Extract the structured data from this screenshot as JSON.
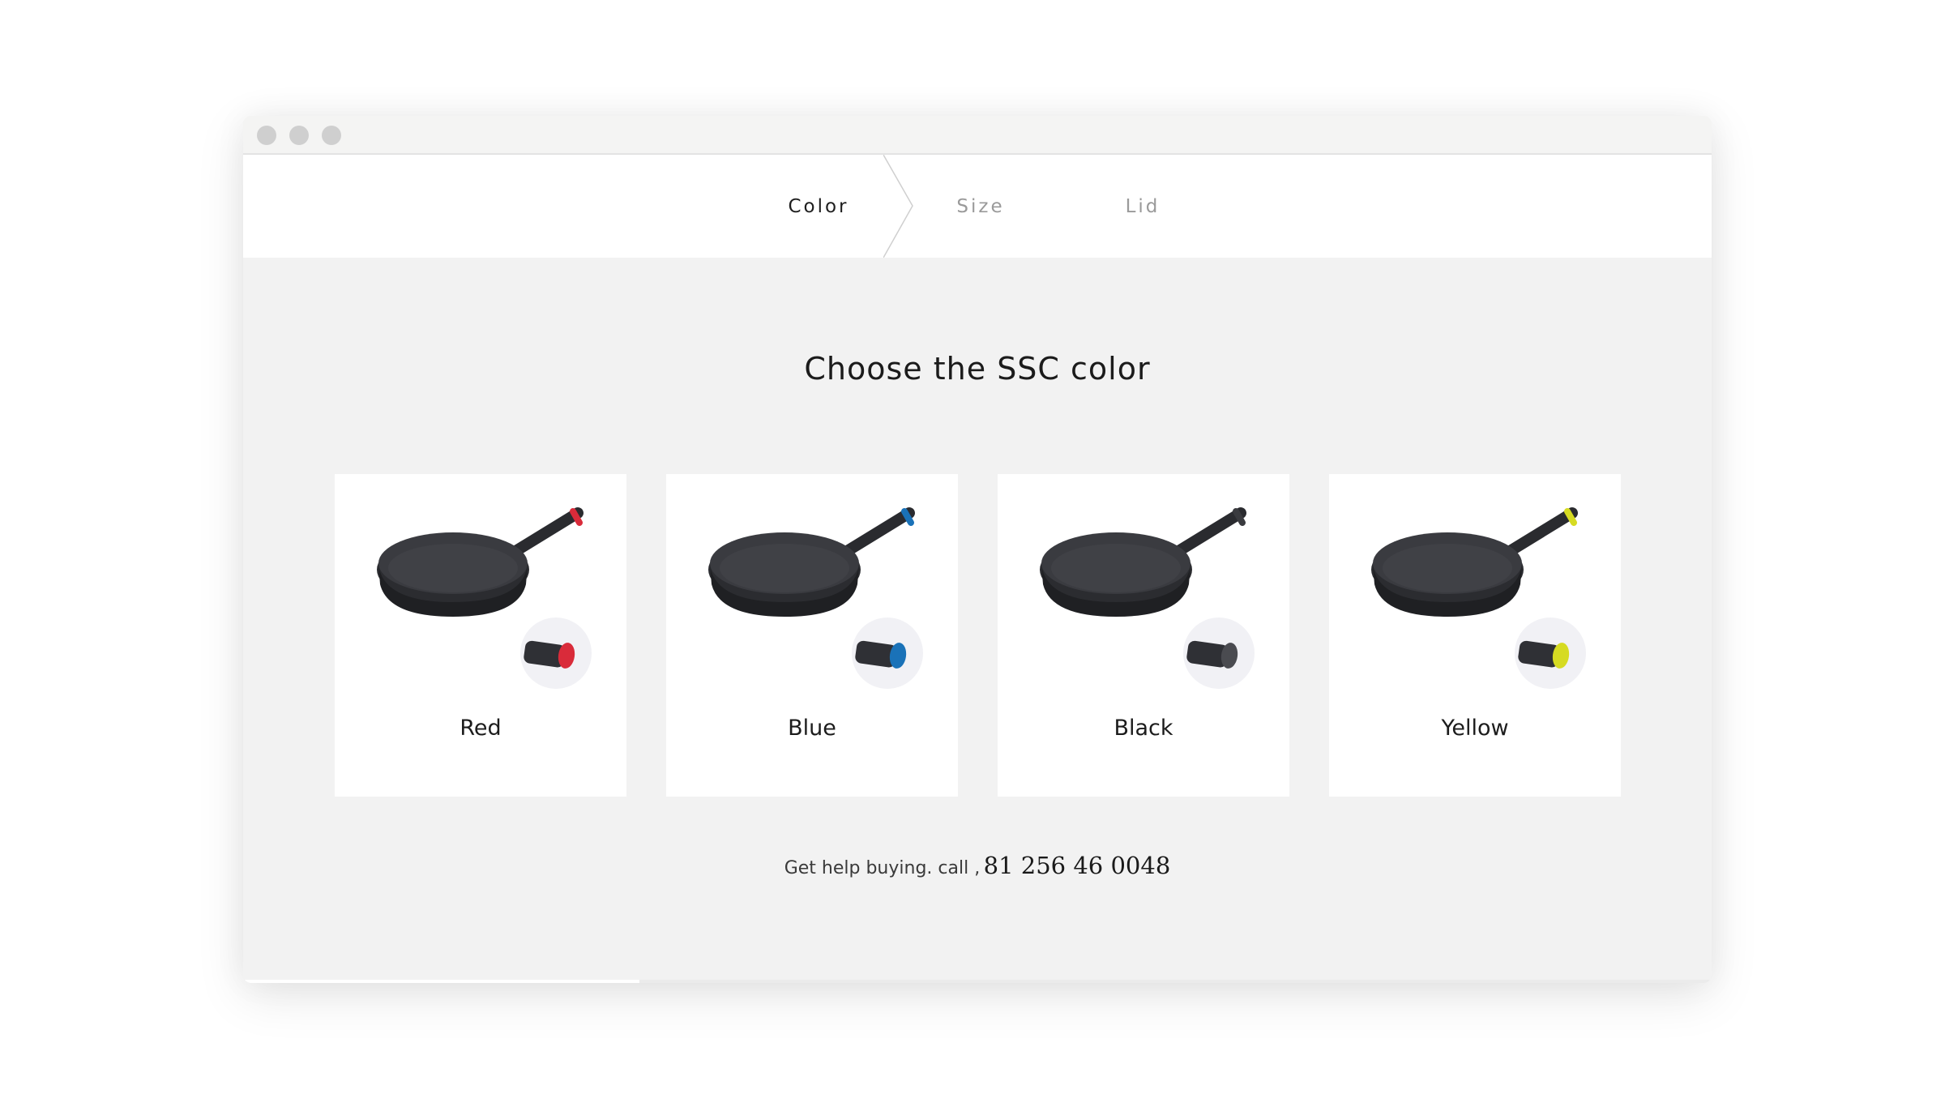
{
  "steps": [
    {
      "label": "Color",
      "active": true
    },
    {
      "label": "Size",
      "active": false
    },
    {
      "label": "Lid",
      "active": false
    }
  ],
  "heading": "Choose the SSC color",
  "colors": [
    {
      "label": "Red",
      "accent": "#d92b3a"
    },
    {
      "label": "Blue",
      "accent": "#1a72b8"
    },
    {
      "label": "Black",
      "accent": "#3a3b3f"
    },
    {
      "label": "Yellow",
      "accent": "#d6db22"
    }
  ],
  "help": {
    "text": "Get help buying. call ,",
    "phone": "81 256 46 0048"
  },
  "progress": 0.27
}
